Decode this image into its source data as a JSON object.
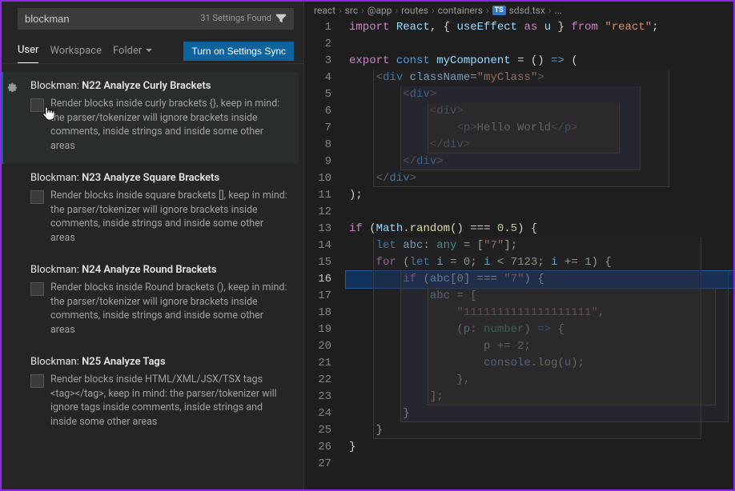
{
  "search": {
    "value": "blockman",
    "count_label": "31 Settings Found"
  },
  "tabs": {
    "user": "User",
    "workspace": "Workspace",
    "folder": "Folder",
    "sync": "Turn on Settings Sync"
  },
  "settings": [
    {
      "prefix": "Blockman: ",
      "name": "N22 Analyze Curly Brackets",
      "desc": "Render blocks inside curly brackets {}, keep in mind: the parser/tokenizer will ignore brackets inside comments, inside strings and inside some other areas",
      "highlight": true
    },
    {
      "prefix": "Blockman: ",
      "name": "N23 Analyze Square Brackets",
      "desc": "Render blocks inside square brackets [], keep in mind: the parser/tokenizer will ignore brackets inside comments, inside strings and inside some other areas",
      "highlight": false
    },
    {
      "prefix": "Blockman: ",
      "name": "N24 Analyze Round Brackets",
      "desc": "Render blocks inside Round brackets (), keep in mind: the parser/tokenizer will ignore brackets inside comments, inside strings and inside some other areas",
      "highlight": false
    },
    {
      "prefix": "Blockman: ",
      "name": "N25 Analyze Tags",
      "desc": "Render blocks inside HTML/XML/JSX/TSX tags <tag></tag>, keep in mind: the parser/tokenizer will ignore tags inside comments, inside strings and inside some other areas",
      "highlight": false
    }
  ],
  "breadcrumbs": [
    "react",
    "src",
    "@app",
    "routes",
    "containers",
    "sdsd.tsx",
    "..."
  ],
  "file_badge": "TS",
  "code_lines": [
    {
      "n": 1,
      "html": "<span class='tk-kw'>import</span> <span class='tk-var'>React</span><span class='tk-op'>, { </span><span class='tk-var'>useEffect</span> <span class='tk-kw'>as</span> <span class='tk-var'>u</span><span class='tk-op'> } </span><span class='tk-kw'>from</span> <span class='tk-str'>\"react\"</span><span class='tk-op'>;</span>"
    },
    {
      "n": 2,
      "html": ""
    },
    {
      "n": 3,
      "html": "<span class='tk-kw'>export</span> <span class='tk-kw2'>const</span> <span class='tk-var'>myComponent</span> <span class='tk-op'>= () </span><span class='tk-kw2'>=&gt;</span> <span class='tk-op'>(</span>"
    },
    {
      "n": 4,
      "html": "    <span class='tk-tag'>&lt;</span><span class='tk-tagname'>div</span> <span class='tk-attr'>className</span><span class='tk-op'>=</span><span class='tk-str'>\"myClass\"</span><span class='tk-tag'>&gt;</span>"
    },
    {
      "n": 5,
      "html": "        <span class='tk-tag'>&lt;</span><span class='tk-tagname'>div</span><span class='tk-tag'>&gt;</span>"
    },
    {
      "n": 6,
      "html": "            <span class='tk-tag'>&lt;</span><span class='tk-tagname'>div</span><span class='tk-tag'>&gt;</span>"
    },
    {
      "n": 7,
      "html": "                <span class='tk-tag'>&lt;</span><span class='tk-tagname'>p</span><span class='tk-tag'>&gt;</span>Hello World<span class='tk-tag'>&lt;/</span><span class='tk-tagname'>p</span><span class='tk-tag'>&gt;</span>"
    },
    {
      "n": 8,
      "html": "            <span class='tk-tag'>&lt;/</span><span class='tk-tagname'>div</span><span class='tk-tag'>&gt;</span>"
    },
    {
      "n": 9,
      "html": "        <span class='tk-tag'>&lt;/</span><span class='tk-tagname'>div</span><span class='tk-tag'>&gt;</span>"
    },
    {
      "n": 10,
      "html": "    <span class='tk-tag'>&lt;/</span><span class='tk-tagname'>div</span><span class='tk-tag'>&gt;</span>"
    },
    {
      "n": 11,
      "html": "<span class='tk-op'>);</span>"
    },
    {
      "n": 12,
      "html": ""
    },
    {
      "n": 13,
      "html": "<span class='tk-kw'>if</span> <span class='tk-op'>(</span><span class='tk-var'>Math</span><span class='tk-op'>.</span><span class='tk-fn'>random</span><span class='tk-op'>() === </span><span class='tk-num'>0.5</span><span class='tk-op'>) {</span>"
    },
    {
      "n": 14,
      "html": "    <span class='tk-kw2'>let</span> <span class='tk-var'>abc</span><span class='tk-op'>: </span><span class='tk-type'>any</span><span class='tk-op'> = [</span><span class='tk-str'>\"7\"</span><span class='tk-op'>];</span>"
    },
    {
      "n": 15,
      "html": "    <span class='tk-kw'>for</span> <span class='tk-op'>(</span><span class='tk-kw2'>let</span> <span class='tk-var'>i</span> <span class='tk-op'>=</span> <span class='tk-num'>0</span><span class='tk-op'>; </span><span class='tk-var'>i</span> <span class='tk-op'>&lt;</span> <span class='tk-num'>7123</span><span class='tk-op'>; </span><span class='tk-var'>i</span> <span class='tk-op'>+=</span> <span class='tk-num'>1</span><span class='tk-op'>) {</span>"
    },
    {
      "n": 16,
      "html": "        <span class='tk-kw'>if</span> <span class='tk-op'>(</span><span class='tk-var'>abc</span><span class='tk-op'>[</span><span class='tk-num'>0</span><span class='tk-op'>] === </span><span class='tk-str'>\"7\"</span><span class='tk-op'>) {</span>",
      "current": true
    },
    {
      "n": 17,
      "html": "            <span class='tk-var'>abc</span> <span class='tk-op'>= [</span>"
    },
    {
      "n": 18,
      "html": "                <span class='tk-str'>\"1111111111111111111\"</span><span class='tk-op'>,</span>"
    },
    {
      "n": 19,
      "html": "                <span class='tk-op'>(</span><span class='tk-var'>p</span><span class='tk-op'>: </span><span class='tk-type'>number</span><span class='tk-op'>) </span><span class='tk-kw2'>=&gt;</span> <span class='tk-op'>{</span>"
    },
    {
      "n": 20,
      "html": "                    <span class='tk-var'>p</span> <span class='tk-op'>+=</span> <span class='tk-num'>2</span><span class='tk-op'>;</span>"
    },
    {
      "n": 21,
      "html": "                    <span class='tk-var'>console</span><span class='tk-op'>.</span><span class='tk-fn'>log</span><span class='tk-op'>(</span><span class='tk-var'>u</span><span class='tk-op'>);</span>"
    },
    {
      "n": 22,
      "html": "                <span class='tk-op'>},</span>"
    },
    {
      "n": 23,
      "html": "            <span class='tk-op'>];</span>"
    },
    {
      "n": 24,
      "html": "        <span class='tk-op'>}</span>"
    },
    {
      "n": 25,
      "html": "    <span class='tk-op'>}</span>"
    },
    {
      "n": 26,
      "html": "<span class='tk-op'>}</span>"
    },
    {
      "n": 27,
      "html": ""
    }
  ]
}
